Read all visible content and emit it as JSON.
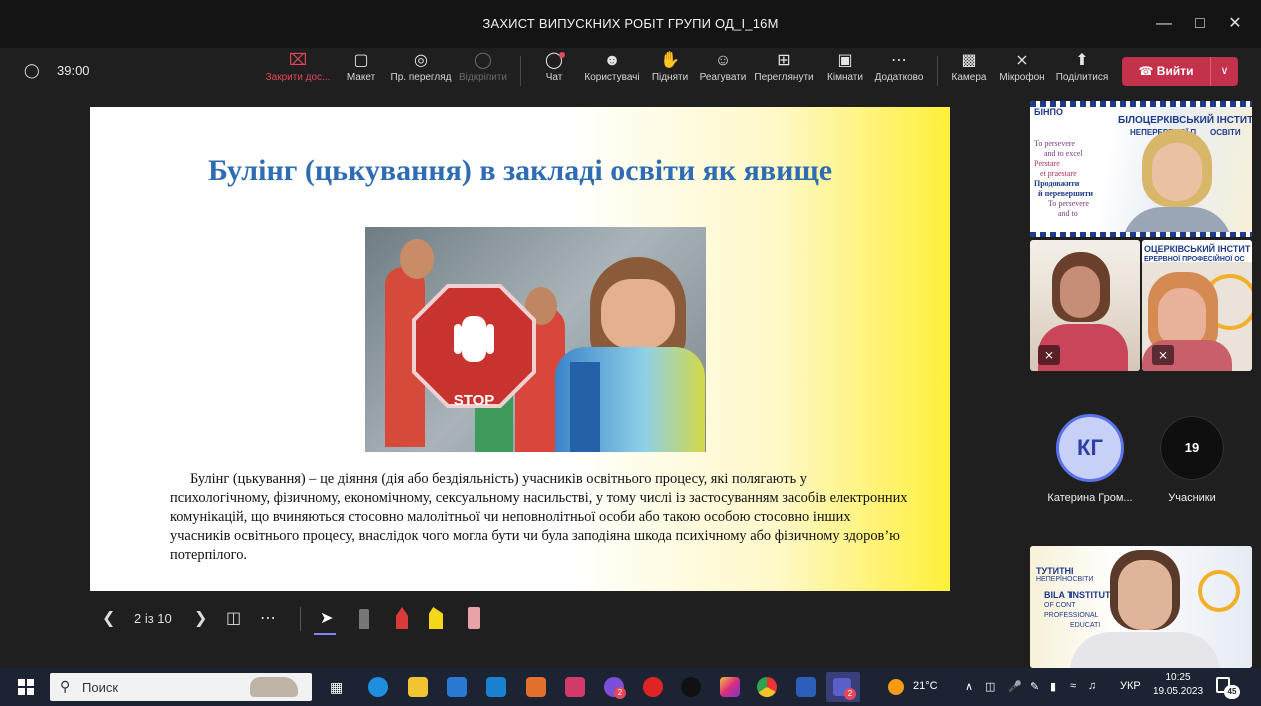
{
  "window": {
    "title": "ЗАХИСТ ВИПУСКНИХ РОБІТ ГРУПИ ОД_І_16М"
  },
  "toolbar": {
    "timer": "39:00",
    "items": [
      {
        "label": "Закрити дос...",
        "icon": "close-box-icon"
      },
      {
        "label": "Макет",
        "icon": "layout-icon"
      },
      {
        "label": "Пр. перегляд",
        "icon": "eye-icon"
      },
      {
        "label": "Відкріпити",
        "icon": "unpin-icon"
      },
      {
        "label": "Чат",
        "icon": "chat-icon"
      },
      {
        "label": "Користувачі",
        "icon": "people-icon"
      },
      {
        "label": "Підняти",
        "icon": "hand-icon"
      },
      {
        "label": "Реагувати",
        "icon": "smile-icon"
      },
      {
        "label": "Переглянути",
        "icon": "grid-icon"
      },
      {
        "label": "Кімнати",
        "icon": "rooms-icon"
      },
      {
        "label": "Додатково",
        "icon": "more-icon"
      },
      {
        "label": "Камера",
        "icon": "camera-icon"
      },
      {
        "label": "Мікрофон",
        "icon": "mic-off-icon"
      },
      {
        "label": "Поділитися",
        "icon": "share-icon"
      }
    ],
    "leave_label": "Вийти"
  },
  "slide": {
    "title": "Булінг (цькування) в закладі освіти як явище",
    "body": "Булінг (цькування) – це діяння (дія або бездіяльність) учасників освітнього процесу, які полягають у психологічному, фізичному, економічному, сексуальному насильстві, у тому числі із застосуванням засобів електронних комунікацій, що вчиняються стосовно малолітньої чи неповнолітньої особи або такою особою стосовно інших учасників освітнього процесу, внаслідок чого могла бути чи була заподіяна шкода психічному або фізичному здоров’ю потерпілого.",
    "image_text": "STOP"
  },
  "slide_controls": {
    "page": "2 із 10"
  },
  "participants": {
    "tile1": {
      "logo": "БІНПО",
      "banner_line1": "БІЛОЦЕРКІВСЬКИЙ ІНСТИТУТ",
      "banner_line2": "НЕПЕРЕРВНОЇ П",
      "banner_line3": "ОСВІТИ",
      "mottos": [
        "To persevere",
        "and to excel",
        "Perstare",
        "et praestare",
        "Продовжити",
        "й перевершити",
        "To persevere",
        "and to"
      ]
    },
    "tile3_banner": [
      "ОЦЕРКІВСЬКИЙ ІНСТИТ",
      "ЕРЕРВНОЇ ПРОФЕСІЙНОЇ ОС"
    ],
    "avatar_initials": "КГ",
    "avatar_name": "Катерина Гром...",
    "count": "19",
    "count_label": "Учасники",
    "tile_bottom_banner": [
      "ТУТИТНІ",
      "НЕПЕР",
      "ЇНОСВІТИ",
      "BILA T",
      "INSTITUTE",
      "OF CONT",
      "PROFESSIONAL",
      "EDUCATI"
    ]
  },
  "taskbar": {
    "search_placeholder": "Поиск",
    "weather": "21°C",
    "lang": "УКР",
    "time": "10:25",
    "date": "19.05.2023",
    "notifications": "45",
    "teams_badge": "2",
    "viber_badge": "2"
  },
  "colors": {
    "accent_blue": "#2e6db3",
    "leave_red": "#c4314b",
    "slide_yellow": "#ffef3a",
    "avatar_blue": "#4f6bed"
  }
}
